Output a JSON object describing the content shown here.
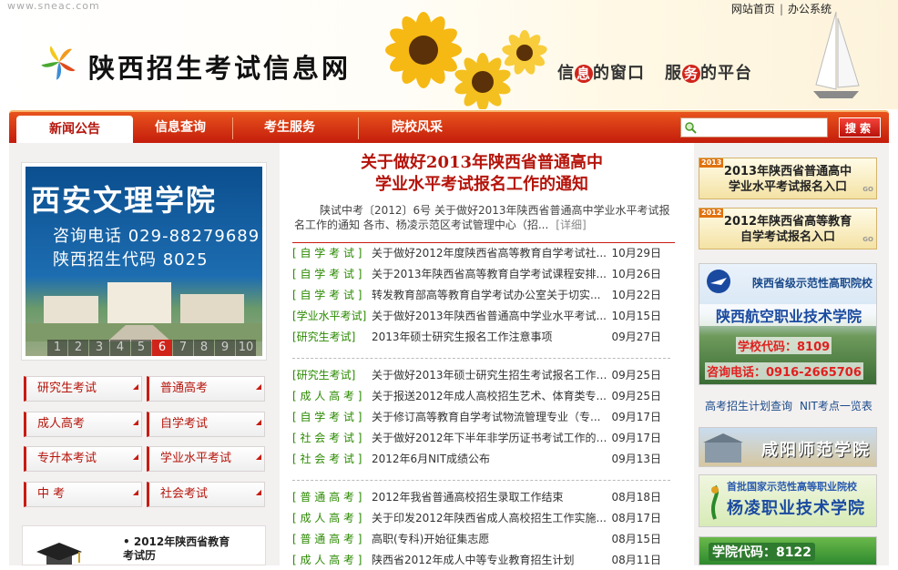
{
  "header": {
    "site_url": "www.sneac.com",
    "top_links": [
      "网站首页",
      "办公系统"
    ],
    "site_title": "陕西招生考试信息网",
    "slogan": {
      "p1": "信",
      "p2": "息",
      "p3": "的窗口",
      "p4": "服",
      "p5": "务",
      "p6": "的平台"
    }
  },
  "nav": {
    "tabs": [
      "新闻公告",
      "信息查询",
      "考生服务",
      "院校风采"
    ],
    "search_placeholder": "",
    "search_button": "搜索"
  },
  "left": {
    "banner": {
      "school": "西安文理学院",
      "phone": "咨询电话 029-88279689",
      "code": "陕西招生代码 8025",
      "pager": [
        "1",
        "2",
        "3",
        "4",
        "5",
        "6",
        "7",
        "8",
        "9",
        "10"
      ],
      "active_page": "6"
    },
    "categories": [
      "研究生考试",
      "普通高考",
      "成人高考",
      "自学考试",
      "专升本考试",
      "学业水平考试",
      "中 考",
      "社会考试"
    ],
    "bottom_title": "2012年陕西省教育考试历"
  },
  "main": {
    "headline_line1": "关于做好2013年陕西省普通高中",
    "headline_line2": "学业水平考试报名工作的通知",
    "summary": "陕试中考〔2012〕6号 关于做好2013年陕西省普通高中学业水平考试报名工作的通知 各市、杨凌示范区考试管理中心（招...",
    "summary_more": "[详细]",
    "groups": [
      [
        {
          "cat": "[ 自 学 考 试 ]",
          "title": "关于做好2012年度陕西省高等教育自学考试社...",
          "date": "10月29日"
        },
        {
          "cat": "[ 自 学 考 试 ]",
          "title": "关于2013年陕西省高等教育自学考试课程安排...",
          "date": "10月26日"
        },
        {
          "cat": "[ 自 学 考 试 ]",
          "title": "转发教育部高等教育自学考试办公室关于切实...",
          "date": "10月22日"
        },
        {
          "cat": "[学业水平考试]",
          "title": "关于做好2013年陕西省普通高中学业水平考试...",
          "date": "10月15日"
        },
        {
          "cat": "[研究生考试]",
          "title": "2013年硕士研究生报名工作注意事项",
          "date": "09月27日"
        }
      ],
      [
        {
          "cat": "[研究生考试]",
          "title": "关于做好2013年硕士研究生招生考试报名工作的...",
          "date": "09月25日"
        },
        {
          "cat": "[ 成 人 高 考 ]",
          "title": "关于报送2012年成人高校招生艺术、体育类专...",
          "date": "09月25日"
        },
        {
          "cat": "[ 自 学 考 试 ]",
          "title": "关于修订高等教育自学考试物流管理专业（专...",
          "date": "09月17日"
        },
        {
          "cat": "[ 社 会 考 试 ]",
          "title": "关于做好2012年下半年非学历证书考试工作的通知",
          "date": "09月17日"
        },
        {
          "cat": "[ 社 会 考 试 ]",
          "title": "2012年6月NIT成绩公布",
          "date": "09月13日"
        }
      ],
      [
        {
          "cat": "[ 普 通 高 考 ]",
          "title": "2012年我省普通高校招生录取工作结束",
          "date": "08月18日"
        },
        {
          "cat": "[ 成 人 高 考 ]",
          "title": "关于印发2012年陕西省成人高校招生工作实施...",
          "date": "08月17日"
        },
        {
          "cat": "[ 普 通 高 考 ]",
          "title": "高职(专科)开始征集志愿",
          "date": "08月15日"
        },
        {
          "cat": "[ 成 人 高 考 ]",
          "title": "陕西省2012年成人中等专业教育招生计划",
          "date": "08月11日"
        }
      ]
    ]
  },
  "right": {
    "promo1": {
      "year": "2013",
      "line1": "2013年陕西省普通高中",
      "line2": "学业水平考试报名入口",
      "go": "GO"
    },
    "promo2": {
      "year": "2012",
      "line1": "2012年陕西省高等教育",
      "line2": "自学考试报名入口",
      "go": "GO"
    },
    "school1": {
      "top": "陕西省级示范性高职院校",
      "name": "陕西航空职业技术学院",
      "code": "学校代码：8109",
      "phone": "咨询电话：0916-2665706"
    },
    "quick_links": [
      "高考招生计划查询",
      "NIT考点一览表"
    ],
    "school2": "咸阳师范学院",
    "school3": {
      "top": "首批国家示范性高等职业院校",
      "name": "杨凌职业技术学院"
    },
    "school4": "学院代码：8122"
  },
  "colors": {
    "brand_red": "#c41d0c",
    "category_green": "#2b8a00"
  }
}
